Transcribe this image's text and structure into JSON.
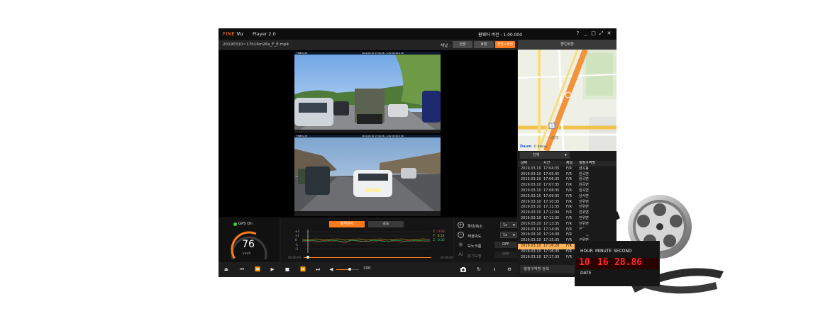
{
  "app": {
    "logo_brand": "FINE",
    "logo_suffix": "Vu",
    "title": "Player 2.0",
    "firmware_label": "펌웨어 버전 : 1.00.000",
    "window_buttons": [
      "?",
      "_",
      "□",
      "⤢",
      "✕"
    ]
  },
  "filebar": {
    "filename": "20190310~17h16m26s_F_E.mp4",
    "channel_label": "채널 :",
    "channels": [
      {
        "label": "전방",
        "active": false
      },
      {
        "label": "후방",
        "active": false
      },
      {
        "label": "전방+후방",
        "active": true
      }
    ]
  },
  "video": {
    "front_cam": {
      "hud_left": "FINEVu X5",
      "hud_right": "2019.03.10 17:16:26 - 1.0V N0 00.0 00"
    },
    "rear_cam": {
      "hud_left": "FINEVu X5",
      "hud_right": "2019.03.10 17:16:26 - 1.0V N0 00.0 00"
    }
  },
  "gps": {
    "label": "GPS On",
    "speed": "76",
    "unit": "km/h",
    "speed_fraction": 0.6
  },
  "graph": {
    "tabs": [
      {
        "label": "충격센서",
        "active": true
      },
      {
        "label": "속도",
        "active": false
      }
    ],
    "y_ticks": [
      "+2",
      "+1",
      "0",
      "-1",
      "-2"
    ],
    "readouts": {
      "x": "X : 0.03",
      "y": "Y : 0.13",
      "z": "Z : 0.05"
    },
    "time_start": "00:00:00",
    "time_end": "00:00:00"
  },
  "controls": {
    "zoom_label": "확대/축소",
    "zoom_value": "1x",
    "speed_label": "재생속도",
    "speed_value": "1x",
    "mono_label": "모노크롬",
    "mono_value": "OFF",
    "ai_label": "밝기보정",
    "ai_value": "OFF"
  },
  "transport": {
    "buttons": [
      "⏏",
      "⏮",
      "⏪",
      "▶",
      "■",
      "⏩",
      "⏭"
    ],
    "volume_icon": "◀",
    "volume_value": "100",
    "volume_fraction": 0.6,
    "right_icons": [
      "camera-icon",
      "rotate-icon",
      "download-icon",
      "gear-icon"
    ]
  },
  "location": {
    "title": "동탄6동",
    "map_labels": {
      "place": "시청역",
      "route": "1",
      "brand": "Daum",
      "copyright": "© Kakao"
    }
  },
  "list": {
    "filter_value": "전체",
    "headers": [
      "날짜",
      "시간",
      "채널",
      "행정구역명"
    ],
    "rows": [
      [
        "2019.03.10",
        "17:04:35",
        "F/R",
        "금곡동"
      ],
      [
        "2019.03.10",
        "17:05:35",
        "F/R",
        "원곡면"
      ],
      [
        "2019.03.10",
        "17:06:35",
        "F/R",
        "원곡면"
      ],
      [
        "2019.03.10",
        "17:07:35",
        "F/R",
        "원곡면"
      ],
      [
        "2019.03.10",
        "17:08:35",
        "F/R",
        "원곡면"
      ],
      [
        "2019.03.10",
        "17:09:35",
        "F/R",
        "남사면"
      ],
      [
        "2019.03.10",
        "17:10:35",
        "F/R",
        "진위면"
      ],
      [
        "2019.03.10",
        "17:11:35",
        "F/R",
        "진위면"
      ],
      [
        "2019.03.10",
        "17:12:04",
        "F/R",
        "진위면"
      ],
      [
        "2019.03.10",
        "17:12:35",
        "F/R",
        "진위면"
      ],
      [
        "2019.03.10",
        "17:13:35",
        "F/R",
        "진위면"
      ],
      [
        "2019.03.10",
        "17:14:35",
        "F/R",
        "진위면"
      ],
      [
        "2019.03.10",
        "17:14:39",
        "F/R",
        "진위면"
      ],
      [
        "2019.03.10",
        "17:15:35",
        "F/R",
        "진위면"
      ],
      [
        "2019.03.10",
        "17:16:26",
        "F/R",
        "진위면"
      ],
      [
        "2019.03.10",
        "17:16:35",
        "F/R",
        "진위면"
      ],
      [
        "2019.03.10",
        "17:17:35",
        "F/R",
        "진위면"
      ]
    ],
    "selected_index": 14,
    "search_label": "행정구역명 검색"
  },
  "clapper": {
    "labels": [
      "HOUR",
      "MINUTE",
      "SECOND"
    ],
    "digits": [
      "10",
      "16",
      "28.86"
    ],
    "date_label": "DATE"
  }
}
